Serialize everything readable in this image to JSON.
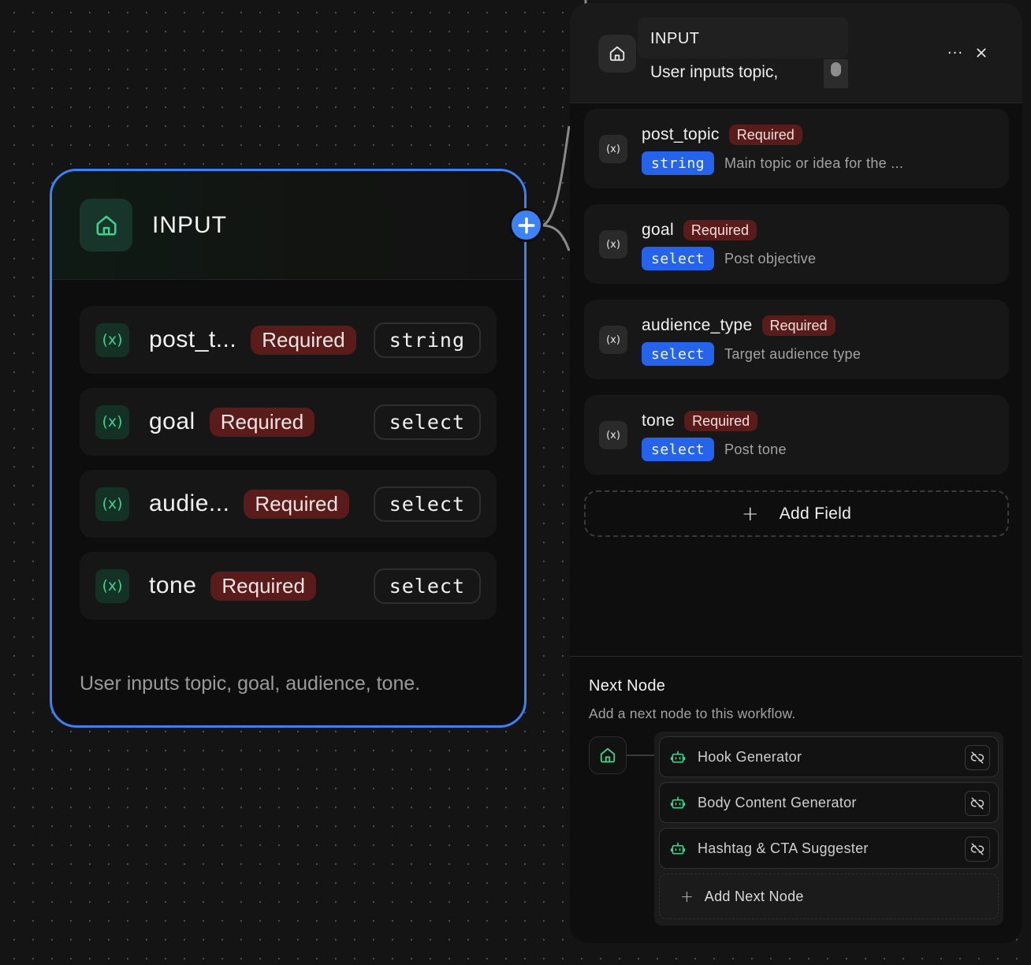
{
  "canvas_node": {
    "title": "INPUT",
    "icon": "home-icon",
    "fields": [
      {
        "name": "post_t...",
        "required": "Required",
        "type": "string"
      },
      {
        "name": "goal",
        "required": "Required",
        "type": "select"
      },
      {
        "name": "audie...",
        "required": "Required",
        "type": "select"
      },
      {
        "name": "tone",
        "required": "Required",
        "type": "select"
      }
    ],
    "description": "User inputs topic, goal, audience, tone.",
    "add_handle_icon": "plus-icon"
  },
  "panel": {
    "title": "INPUT",
    "subtitle": "User inputs topic,",
    "more_label": "···",
    "fields": [
      {
        "name": "post_topic",
        "required": "Required",
        "type": "string",
        "description": "Main topic or idea for the ..."
      },
      {
        "name": "goal",
        "required": "Required",
        "type": "select",
        "description": "Post objective"
      },
      {
        "name": "audience_type",
        "required": "Required",
        "type": "select",
        "description": "Target audience type"
      },
      {
        "name": "tone",
        "required": "Required",
        "type": "select",
        "description": "Post tone"
      }
    ],
    "add_field": {
      "plus": "+",
      "label": "Add Field"
    },
    "next_node": {
      "title": "Next Node",
      "subtitle": "Add a next node to this workflow.",
      "items": [
        {
          "label": "Hook Generator"
        },
        {
          "label": "Body Content Generator"
        },
        {
          "label": "Hashtag & CTA Suggester"
        }
      ],
      "add_plus": "+",
      "add_label": "Add Next Node"
    }
  },
  "colors": {
    "accent_blue": "#3b82f6",
    "required_bg": "#5a1b1b",
    "type_pill_bg": "#2563eb",
    "var_green": "#3fcf8e",
    "background": "#141414"
  }
}
